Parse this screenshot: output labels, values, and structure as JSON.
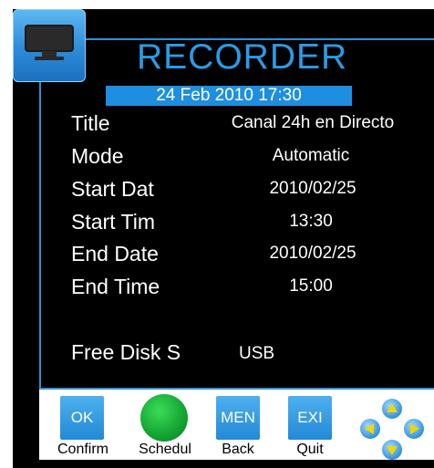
{
  "header": {
    "title": "RECORDER",
    "datetime": "24 Feb 2010  17:30"
  },
  "details": [
    {
      "label": "Title",
      "value": "Canal 24h en Directo"
    },
    {
      "label": "Mode",
      "value": "Automatic"
    },
    {
      "label": "Start Dat",
      "value": "2010/02/25"
    },
    {
      "label": "Start Tim",
      "value": "13:30"
    },
    {
      "label": "End Date",
      "value": "2010/02/25"
    },
    {
      "label": "End Time",
      "value": "15:00"
    },
    {
      "label": "Free Disk S",
      "value": "USB"
    }
  ],
  "buttons": {
    "ok": {
      "text": "OK",
      "caption": "Confirm"
    },
    "schedule": {
      "caption": "Schedul"
    },
    "menu": {
      "text": "MEN",
      "caption": "Back"
    },
    "exit": {
      "text": "EXI",
      "caption": "Quit"
    }
  },
  "icons": {
    "tv": "tv-icon",
    "dpad": "directional-pad-icon"
  },
  "colors": {
    "accent": "#2a9be6",
    "datebar": "#1e8fe0",
    "button": "#2389d6",
    "schedule_button": "#16a834",
    "dpad_arrow": "#f2d500"
  }
}
